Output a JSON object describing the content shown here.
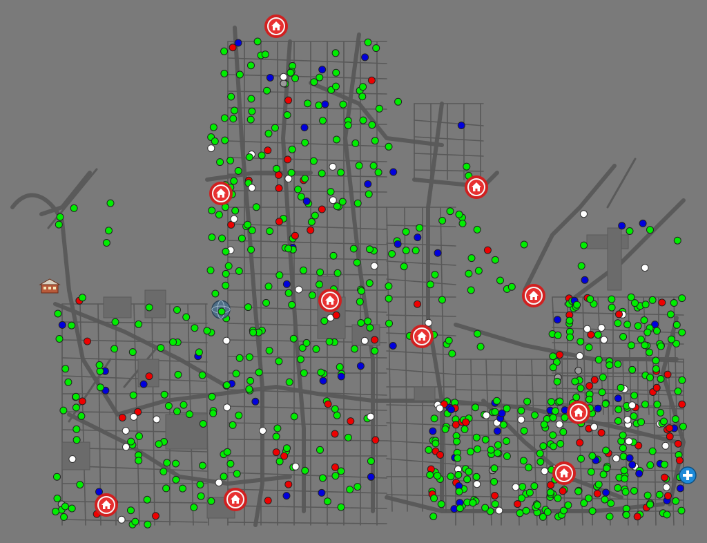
{
  "map": {
    "background": "#7a7a7a",
    "road_color": "#5a5a5a",
    "block_color": "#6b6b6b"
  },
  "marker_colors": {
    "active": "#00ee00",
    "alert": "#ee0000",
    "info": "#0000dd",
    "idle": "#ffffff",
    "unknown": "#9a9a9a"
  },
  "icons": {
    "home_marker": "house-icon",
    "school_marker": "school-building-icon",
    "globe_marker": "globe-icon",
    "zoom_in": "plus-icon"
  }
}
